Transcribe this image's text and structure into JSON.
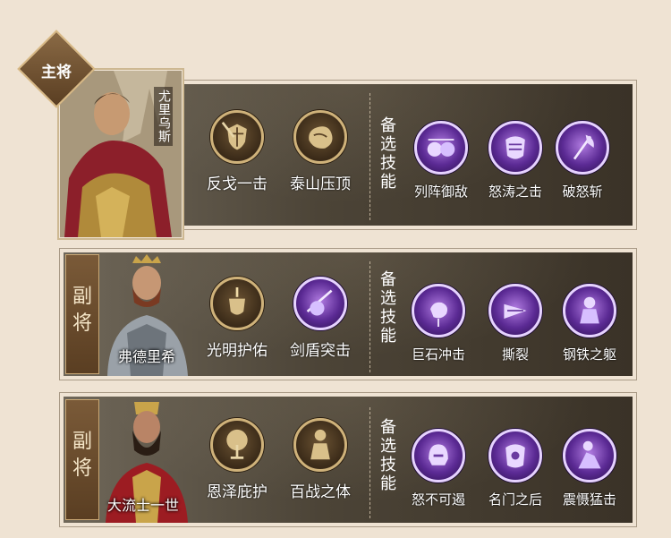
{
  "cards": [
    {
      "role": "主将",
      "general_name": "尤里乌斯",
      "main_skills": [
        {
          "label": "反戈一击",
          "icon": "shield-sword-icon"
        },
        {
          "label": "泰山压顶",
          "icon": "boulder-icon"
        }
      ],
      "alt_title": "备选技能",
      "alt_skills": [
        {
          "label": "列阵御敌",
          "icon": "shield-wall-icon"
        },
        {
          "label": "怒涛之击",
          "icon": "armor-strike-icon"
        },
        {
          "label": "破怒斩",
          "icon": "axe-icon"
        }
      ]
    },
    {
      "role": "副将",
      "general_name": "弗德里希",
      "main_skills": [
        {
          "label": "光明护佑",
          "icon": "holy-shield-icon"
        },
        {
          "label": "剑盾突击",
          "icon": "sword-shield-charge-icon"
        }
      ],
      "alt_title": "备选技能",
      "alt_skills": [
        {
          "label": "巨石冲击",
          "icon": "rock-impact-icon"
        },
        {
          "label": "撕裂",
          "icon": "tear-icon"
        },
        {
          "label": "钢铁之躯",
          "icon": "iron-body-icon"
        }
      ]
    },
    {
      "role": "副将",
      "general_name": "大流士一世",
      "main_skills": [
        {
          "label": "恩泽庇护",
          "icon": "tree-icon"
        },
        {
          "label": "百战之体",
          "icon": "warrior-body-icon"
        }
      ],
      "alt_title": "备选技能",
      "alt_skills": [
        {
          "label": "怒不可遏",
          "icon": "helmet-rage-icon"
        },
        {
          "label": "名门之后",
          "icon": "noble-armor-icon"
        },
        {
          "label": "震慑猛击",
          "icon": "slam-icon"
        }
      ]
    }
  ],
  "colors": {
    "page_bg": "#efe3d3",
    "gold_ring": "#cfb27a",
    "purple_ring": "#e6d2ff",
    "purple_core": "#5b2a94"
  }
}
